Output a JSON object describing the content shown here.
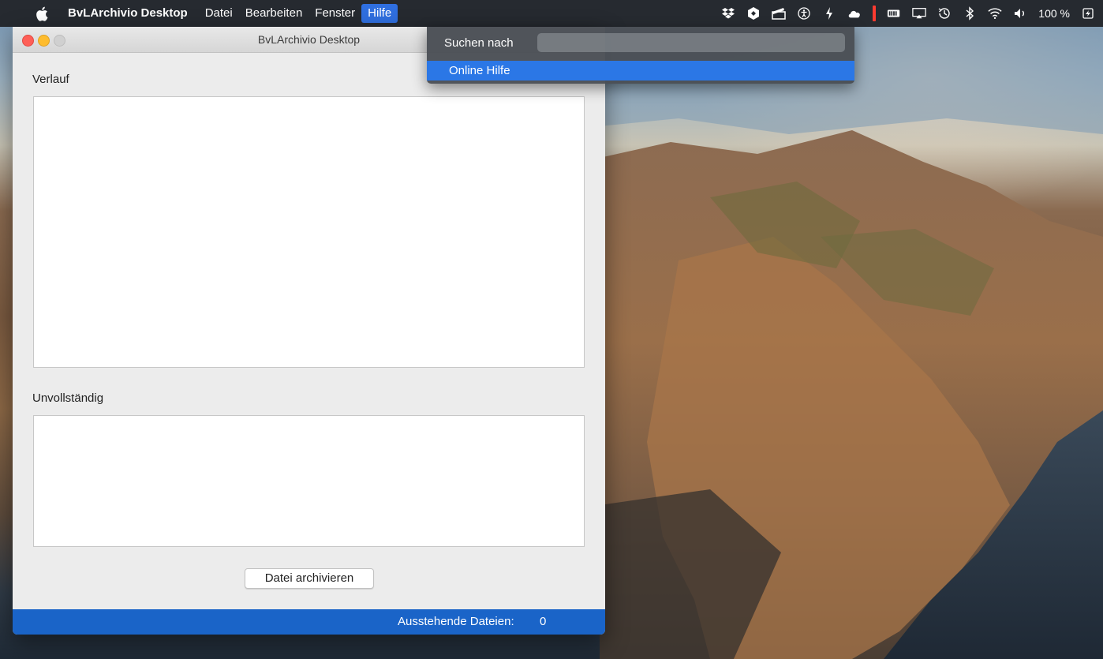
{
  "menubar": {
    "app_name": "BvLArchivio Desktop",
    "items": [
      "Datei",
      "Bearbeiten",
      "Fenster",
      "Hilfe"
    ],
    "active_item": "Hilfe",
    "status_icons": [
      "dropbox-icon",
      "hexagon-app-icon",
      "clapper-icon",
      "accessibility-icon",
      "power-plug-icon",
      "cloud-icon",
      "red-bar-indicator",
      "battery-device-icon",
      "airplay-icon",
      "time-machine-icon",
      "bluetooth-icon",
      "wifi-icon",
      "volume-icon",
      "battery-icon"
    ],
    "battery_text": "100 %"
  },
  "help_menu": {
    "search_label": "Suchen nach",
    "search_value": "",
    "online_help_label": "Online Hilfe"
  },
  "window": {
    "title": "BvLArchivio Desktop",
    "history_label": "Verlauf",
    "incomplete_label": "Unvollständig",
    "archive_button_label": "Datei archivieren",
    "pending_label": "Ausstehende Dateien:",
    "pending_count": "0"
  },
  "colors": {
    "menubar_bg": "#262a30",
    "selection_blue": "#2b77e6",
    "statusbar_blue": "#1a64c8"
  }
}
